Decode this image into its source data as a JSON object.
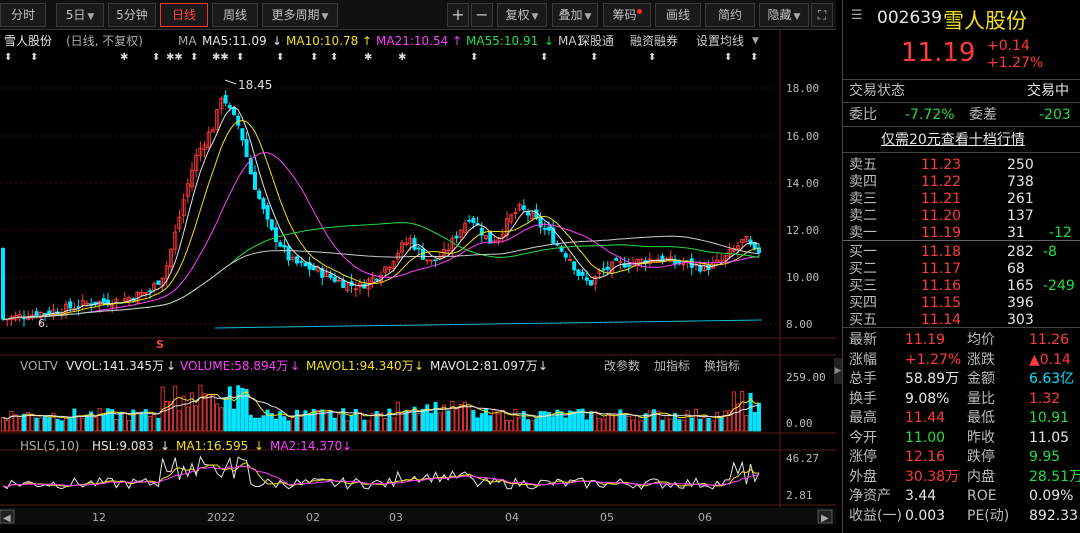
{
  "toolbar": {
    "tabs": [
      "分时",
      "5日",
      "5分钟",
      "日线",
      "周线",
      "更多周期"
    ],
    "active_tab": "日线",
    "plus": "+",
    "minus": "−",
    "fuquan": "复权",
    "diejia": "叠加",
    "chouma": "筹码",
    "huaxian": "画线",
    "jianyue": "简约",
    "yincang": "隐藏"
  },
  "info": {
    "stock_name": "雪人股份",
    "period_note": "(日线, 不复权)",
    "ma_label": "MA",
    "ma5": "MA5:11.09",
    "ma10": "MA10:10.78",
    "ma21": "MA21:10.54",
    "ma55": "MA55:10.91",
    "ma1": "MA1",
    "shengutong": "深股通",
    "rongzi": "融资融券",
    "shezhi": "设置均线"
  },
  "main_chart": {
    "y_ticks": [
      "18.00",
      "16.00",
      "14.00",
      "12.00",
      "10.00",
      "8.00"
    ],
    "high_label": "18.45",
    "low_label": "6.",
    "s_marker": "S"
  },
  "volume": {
    "label": "VOLTV",
    "vvol": "VVOL:141.345万",
    "volume": "VOLUME:58.894万",
    "mavol1": "MAVOL1:94.340万",
    "mavol2": "MAVOL2:81.097万",
    "y_ticks": [
      "259.00",
      "0.00"
    ]
  },
  "hsl": {
    "label": "HSL(5,10)",
    "hsl": "HSL:9.083",
    "ma1": "MA1:16.595",
    "ma2": "MA2:14.370",
    "y_ticks": [
      "46.27",
      "2.81"
    ]
  },
  "panel_buttons": [
    "改参数",
    "加指标",
    "换指标"
  ],
  "x_axis": [
    "12",
    "2022",
    "02",
    "03",
    "04",
    "05",
    "06"
  ],
  "quote": {
    "code": "002639",
    "name": "雪人股份",
    "price": "11.19",
    "change": "+0.14",
    "change_pct": "+1.27%",
    "trade_status_label": "交易状态",
    "trade_status": "交易中",
    "weibi_label": "委比",
    "weibi": "-7.72%",
    "weicha_label": "委差",
    "weicha": "-203",
    "promo": "仅需20元查看十档行情",
    "sell": [
      {
        "label": "卖五",
        "price": "11.23",
        "vol": "250",
        "chg": ""
      },
      {
        "label": "卖四",
        "price": "11.22",
        "vol": "738",
        "chg": ""
      },
      {
        "label": "卖三",
        "price": "11.21",
        "vol": "261",
        "chg": ""
      },
      {
        "label": "卖二",
        "price": "11.20",
        "vol": "137",
        "chg": ""
      },
      {
        "label": "卖一",
        "price": "11.19",
        "vol": "31",
        "chg": "-12"
      }
    ],
    "buy": [
      {
        "label": "买一",
        "price": "11.18",
        "vol": "282",
        "chg": "-8"
      },
      {
        "label": "买二",
        "price": "11.17",
        "vol": "68",
        "chg": ""
      },
      {
        "label": "买三",
        "price": "11.16",
        "vol": "165",
        "chg": "-249"
      },
      {
        "label": "买四",
        "price": "11.15",
        "vol": "396",
        "chg": ""
      },
      {
        "label": "买五",
        "price": "11.14",
        "vol": "303",
        "chg": ""
      }
    ],
    "stats": [
      {
        "l1": "最新",
        "v1": "11.19",
        "c1": "red",
        "l2": "均价",
        "v2": "11.26",
        "c2": "red"
      },
      {
        "l1": "涨幅",
        "v1": "+1.27%",
        "c1": "red",
        "l2": "涨跌",
        "v2": "▲0.14",
        "c2": "red"
      },
      {
        "l1": "总手",
        "v1": "58.89万",
        "c1": "white",
        "l2": "金额",
        "v2": "6.63亿",
        "c2": "cyan"
      },
      {
        "l1": "换手",
        "v1": "9.08%",
        "c1": "white",
        "l2": "量比",
        "v2": "1.32",
        "c2": "red"
      },
      {
        "l1": "最高",
        "v1": "11.44",
        "c1": "red",
        "l2": "最低",
        "v2": "10.91",
        "c2": "green"
      },
      {
        "l1": "今开",
        "v1": "11.00",
        "c1": "green",
        "l2": "昨收",
        "v2": "11.05",
        "c2": "white"
      },
      {
        "l1": "涨停",
        "v1": "12.16",
        "c1": "red",
        "l2": "跌停",
        "v2": "9.95",
        "c2": "green"
      },
      {
        "l1": "外盘",
        "v1": "30.38万",
        "c1": "red",
        "l2": "内盘",
        "v2": "28.51万",
        "c2": "green"
      },
      {
        "l1": "净资产",
        "v1": "3.44",
        "c1": "white",
        "l2": "ROE",
        "v2": "0.09%",
        "c2": "white"
      },
      {
        "l1": "收益(一)",
        "v1": "0.003",
        "c1": "white",
        "l2": "PE(动)",
        "v2": "892.33",
        "c2": "white"
      }
    ]
  },
  "colors": {
    "up": "#ff3b3b",
    "down": "#00e5ff",
    "ma5": "#e6e6e6",
    "ma10": "#f0e020",
    "ma21": "#ff40ff",
    "ma55": "#22dd44"
  }
}
